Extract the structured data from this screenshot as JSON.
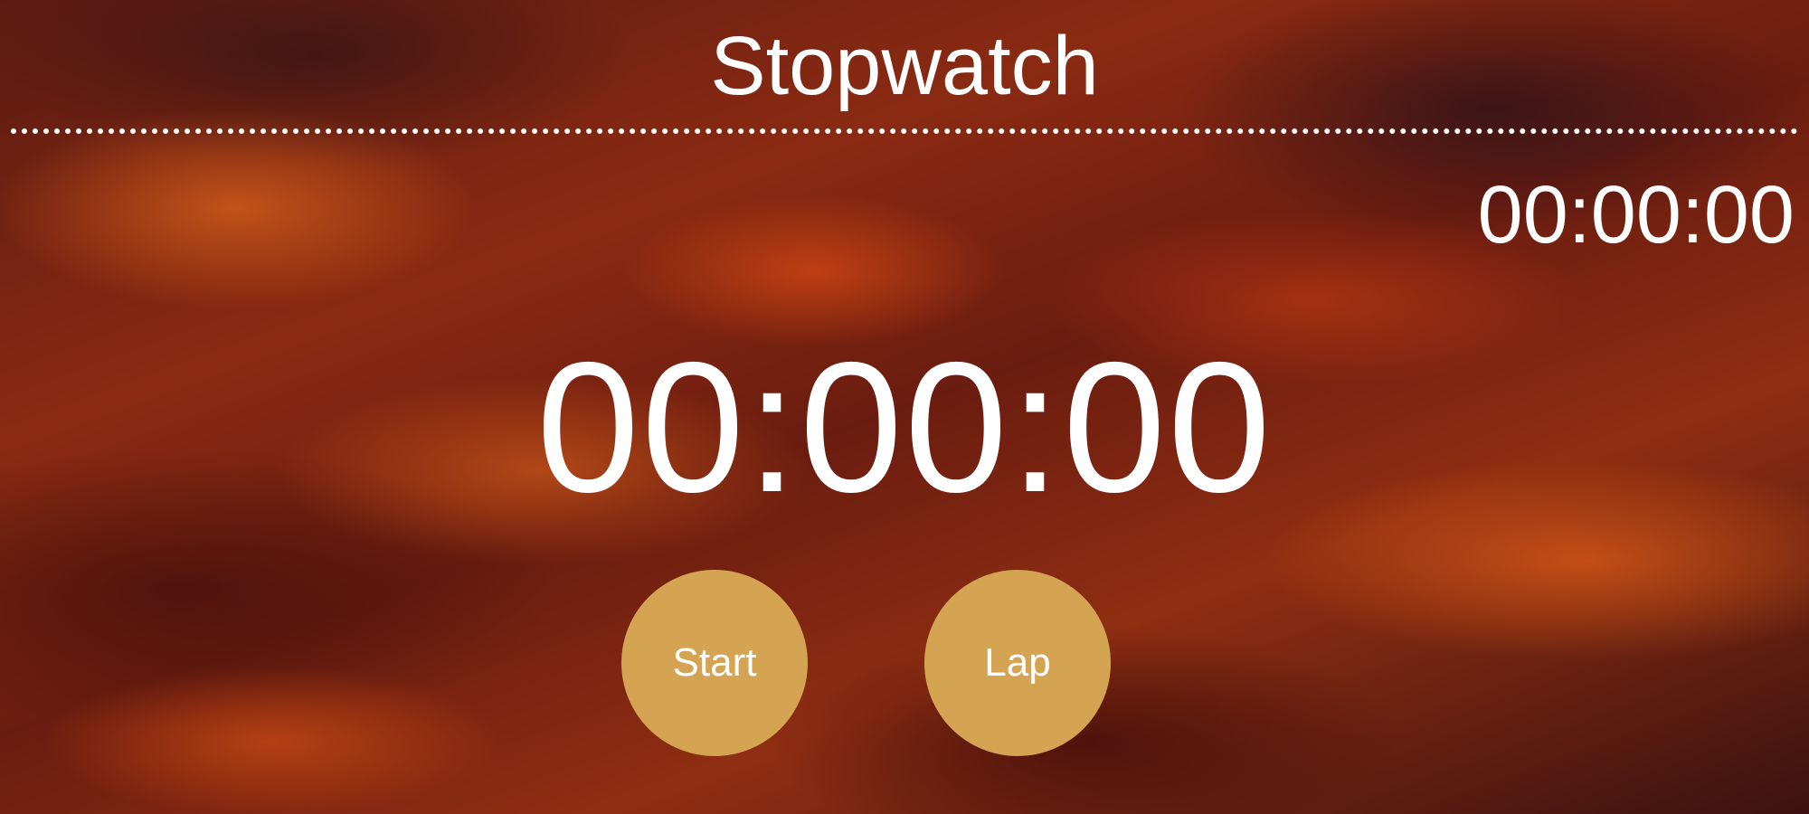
{
  "app": {
    "title": "Stopwatch"
  },
  "lap_display": {
    "time": "00:00:00"
  },
  "main_display": {
    "time": "00:00:00"
  },
  "controls": {
    "start_label": "Start",
    "lap_label": "Lap",
    "button_color": "#d4a453"
  },
  "theme": {
    "text_color": "#ffffff",
    "background": "fiery sunset clouds"
  }
}
